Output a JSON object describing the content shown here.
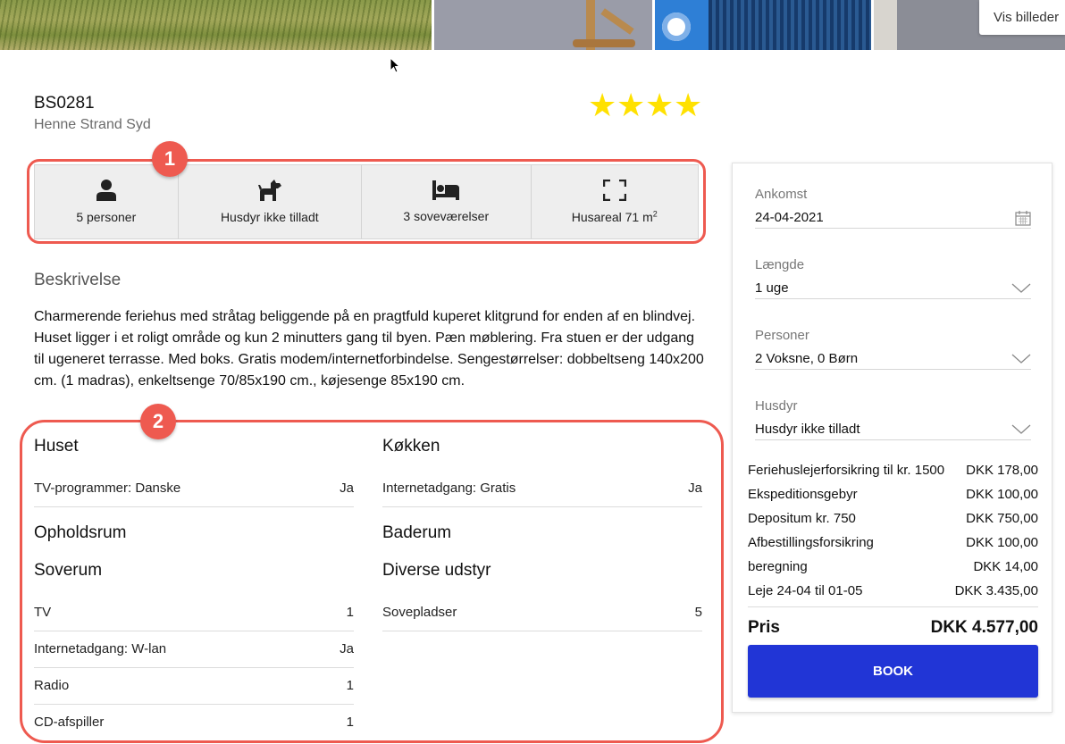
{
  "gallery": {
    "button_label": "Vis billeder"
  },
  "header": {
    "title": "BS0281",
    "subtitle": "Henne Strand Syd",
    "rating": 4,
    "star_color": "#ffe100"
  },
  "annotations": [
    "1",
    "2"
  ],
  "features": [
    {
      "icon": "person-icon",
      "label": "5 personer"
    },
    {
      "icon": "dog-icon",
      "label": "Husdyr ikke tilladt"
    },
    {
      "icon": "bed-icon",
      "label": "3 soveværelser"
    },
    {
      "icon": "expand-icon",
      "label": "Husareal 71 m",
      "sup": "2"
    }
  ],
  "description": {
    "heading": "Beskrivelse",
    "text": "Charmerende feriehus med stråtag beliggende på en pragtfuld kuperet klitgrund for enden af en blindvej. Huset ligger i et roligt område og kun 2 minutters gang til byen. Pæn møblering. Fra stuen er der udgang til ugeneret terrasse. Med boks. Gratis modem/internetforbindelse. Sengestørrelser: dobbeltseng 140x200 cm. (1 madras), enkeltsenge 70/85x190 cm., køjesenge 85x190 cm."
  },
  "amenities": {
    "left": {
      "huset": {
        "title": "Huset",
        "rows": [
          {
            "label": "TV-programmer: Danske",
            "value": "Ja"
          }
        ]
      },
      "opholdsrum": {
        "title": "Opholdsrum"
      },
      "soverum": {
        "title": "Soverum",
        "rows": [
          {
            "label": "TV",
            "value": "1"
          },
          {
            "label": "Internetadgang: W-lan",
            "value": "Ja"
          },
          {
            "label": "Radio",
            "value": "1"
          },
          {
            "label": "CD-afspiller",
            "value": "1"
          }
        ]
      }
    },
    "right": {
      "kokken": {
        "title": "Køkken",
        "rows": [
          {
            "label": "Internetadgang: Gratis",
            "value": "Ja"
          }
        ]
      },
      "baderum": {
        "title": "Baderum"
      },
      "diverse": {
        "title": "Diverse udstyr",
        "rows": [
          {
            "label": "Sovepladser",
            "value": "5"
          }
        ]
      }
    }
  },
  "booking": {
    "arrival": {
      "label": "Ankomst",
      "value": "24-04-2021"
    },
    "length": {
      "label": "Længde",
      "value": "1 uge"
    },
    "persons": {
      "label": "Personer",
      "value": "2 Voksne, 0 Børn"
    },
    "pets": {
      "label": "Husdyr",
      "value": "Husdyr ikke tilladt"
    },
    "prices": [
      {
        "label": "Feriehuslejerforsikring til kr. 1500",
        "value": "DKK 178,00"
      },
      {
        "label": "Ekspeditionsgebyr",
        "value": "DKK 100,00"
      },
      {
        "label": "Depositum kr. 750",
        "value": "DKK 750,00"
      },
      {
        "label": "Afbestillingsforsikring",
        "value": "DKK 100,00"
      },
      {
        "label": "beregning",
        "value": "DKK 14,00"
      },
      {
        "label": "Leje 24-04 til 01-05",
        "value": "DKK 3.435,00"
      }
    ],
    "total": {
      "label": "Pris",
      "value": "DKK 4.577,00"
    },
    "book_label": "BOOK",
    "button_color": "#2135d6"
  },
  "accent_color": "#ee5a50"
}
